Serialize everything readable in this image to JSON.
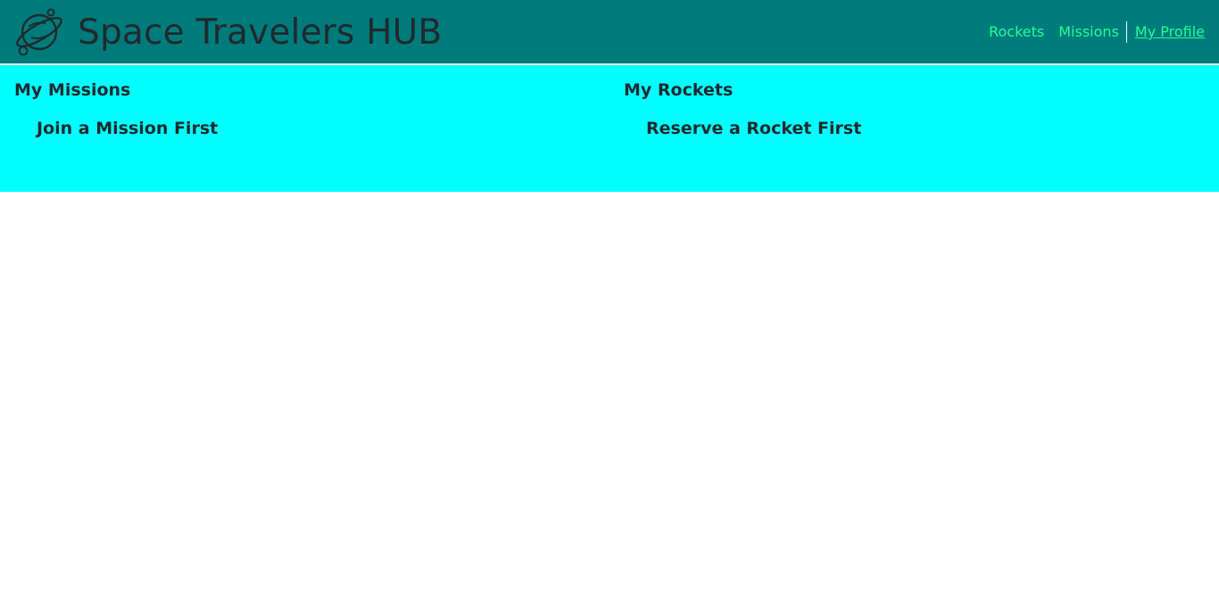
{
  "header": {
    "logo_icon": "planet-icon",
    "title": "Space Travelers HUB",
    "bg_color": "#007b7b"
  },
  "nav": {
    "items": [
      {
        "label": "Rockets"
      },
      {
        "label": "Missions"
      },
      {
        "label": "My Profile",
        "active": true
      }
    ],
    "link_color": "#1cff95"
  },
  "profile": {
    "bg_color": "#00ffff",
    "missions": {
      "title": "My Missions",
      "empty_text": "Join a Mission First"
    },
    "rockets": {
      "title": "My Rockets",
      "empty_text": "Reserve a Rocket First"
    }
  }
}
